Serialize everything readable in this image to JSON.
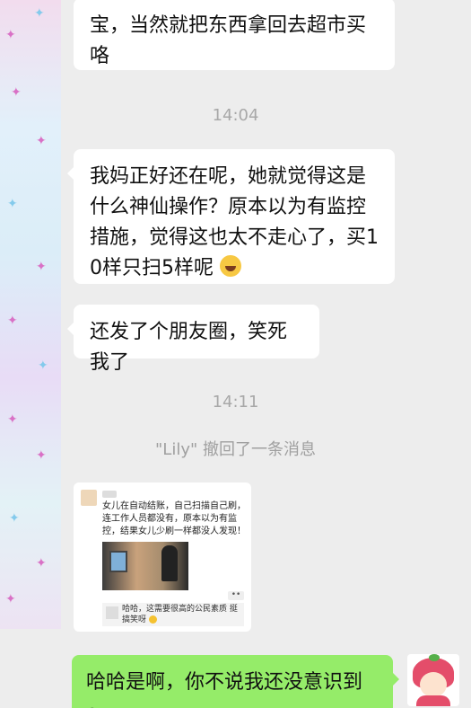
{
  "messages": [
    {
      "id": "m1",
      "text": "宝，当然就把东西拿回去超市买咯"
    },
    {
      "id": "m2",
      "text": "我妈正好还在呢，她就觉得这是什么神仙操作？原本以为有监控措施，觉得这也太不走心了，买10样只扫5样呢"
    },
    {
      "id": "m3",
      "text": "还发了个朋友圈，笑死我了"
    }
  ],
  "timestamps": {
    "t1": "14:04",
    "t2": "14:11"
  },
  "recall_notice": "\"Lily\" 撤回了一条消息",
  "moment_card": {
    "post_text": "女儿在自动结账，自己扫描自己刷，连工作人员都没有，原本以为有监控，结果女儿少刷一样都没人发现！",
    "more": "••",
    "reply_text": "哈哈，这需要很高的公民素质 挺搞笑呀"
  },
  "my_message": {
    "text": "哈哈是啊，你不说我还没意识到o;"
  },
  "colors": {
    "background": "#ededed",
    "incoming_bubble": "#ffffff",
    "outgoing_bubble": "#95ec69",
    "timestamp": "#a8a8a8"
  },
  "icons": {
    "emoji_laugh": "face-with-tears-of-joy",
    "avatar_mine": "cartoon-strawberry-girl"
  }
}
